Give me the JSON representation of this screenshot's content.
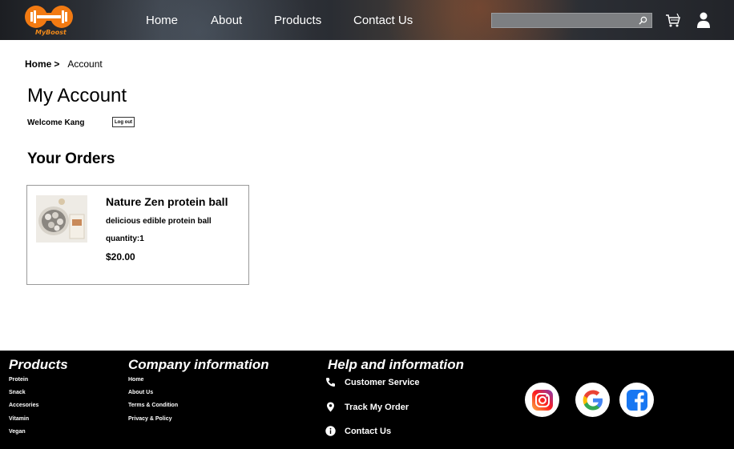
{
  "header": {
    "logo_text": "MyBoost",
    "nav": [
      "Home",
      "About",
      "Products",
      "Contact Us"
    ],
    "search": {
      "value": "",
      "placeholder": ""
    }
  },
  "breadcrumb": {
    "home": "Home",
    "separator": ">",
    "current": "Account"
  },
  "account": {
    "title": "My Account",
    "welcome": "Welcome Kang",
    "logout_label": "Log out"
  },
  "orders": {
    "title": "Your Orders",
    "items": [
      {
        "name": "Nature Zen protein ball",
        "description": "delicious edible protein ball",
        "quantity": "quantity:1",
        "price": "$20.00"
      }
    ]
  },
  "footer": {
    "products": {
      "heading": "Products",
      "links": [
        "Protein",
        "Snack",
        "Accesories",
        "Vitamin",
        "Vegan"
      ]
    },
    "company": {
      "heading": "Company information",
      "links": [
        "Home",
        "About Us",
        "Terms & Condition",
        "Privacy & Policy"
      ]
    },
    "help": {
      "heading": "Help and information",
      "links": [
        "Customer Service",
        "Track My Order",
        "Contact Us"
      ]
    },
    "social": [
      "instagram-icon",
      "google-icon",
      "facebook-icon"
    ]
  },
  "colors": {
    "brand_orange": "#f28a1a",
    "footer_bg": "#000000"
  }
}
